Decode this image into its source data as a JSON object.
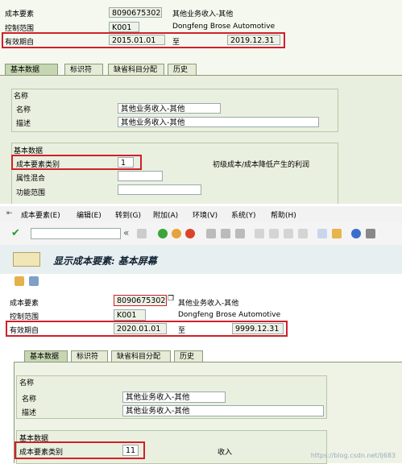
{
  "top": {
    "header": {
      "cost_element_label": "成本要素",
      "cost_element_value": "8090675302",
      "cost_element_desc": "其他业务收入-其他",
      "controlling_area_label": "控制范围",
      "controlling_area_value": "K001",
      "controlling_area_desc": "Dongfeng Brose Automotive",
      "valid_from_label": "有效期自",
      "valid_from_value": "2015.01.01",
      "to_label": "至",
      "valid_to_value": "2019.12.31"
    },
    "tabs": [
      "基本数据",
      "标识符",
      "缺省科目分配",
      "历史"
    ],
    "names": {
      "group_title": "名称",
      "name_label": "名称",
      "name_value": "其他业务收入-其他",
      "desc_label": "描述",
      "desc_value": "其他业务收入-其他"
    },
    "basic": {
      "group_title": "基本数据",
      "category_label": "成本要素类别",
      "category_value": "1",
      "category_desc": "初级成本/成本降低产生的利润",
      "attr_label": "属性混合",
      "func_label": "功能范围"
    }
  },
  "menu": {
    "items": [
      "成本要素(E)",
      "编辑(E)",
      "转到(G)",
      "附加(A)",
      "环境(V)",
      "系统(Y)",
      "帮助(H)"
    ]
  },
  "toolbar": {
    "command_value": "",
    "icons": [
      "check-icon",
      "back-arrows-icon",
      "save-icon",
      "back-icon",
      "exit-icon",
      "cancel-icon",
      "print-icon",
      "find-icon",
      "find-next-icon",
      "first-page-icon",
      "prev-page-icon",
      "next-page-icon",
      "last-page-icon",
      "new-session-icon",
      "shortcut-icon",
      "help-icon",
      "layout-icon"
    ]
  },
  "screen": {
    "title": "显示成本要素: 基本屏幕",
    "header": {
      "cost_element_label": "成本要素",
      "cost_element_value": "8090675302",
      "cost_element_desc": "其他业务收入-其他",
      "controlling_area_label": "控制范围",
      "controlling_area_value": "K001",
      "controlling_area_desc": "Dongfeng Brose Automotive",
      "valid_from_label": "有效期自",
      "valid_from_value": "2020.01.01",
      "to_label": "至",
      "valid_to_value": "9999.12.31"
    },
    "tabs": [
      "基本数据",
      "标识符",
      "缺省科目分配",
      "历史"
    ],
    "names": {
      "group_title": "名称",
      "name_label": "名称",
      "name_value": "其他业务收入-其他",
      "desc_label": "描述",
      "desc_value": "其他业务收入-其他"
    },
    "basic": {
      "group_title": "基本数据",
      "category_label": "成本要素类别",
      "category_value": "11",
      "category_desc": "收入"
    }
  },
  "watermark": "https://blog.csdn.net/lj683",
  "colors": {
    "highlight_red": "#d0202a",
    "panel_green": "#eaf0df",
    "active_tab": "#c7d6b2"
  }
}
